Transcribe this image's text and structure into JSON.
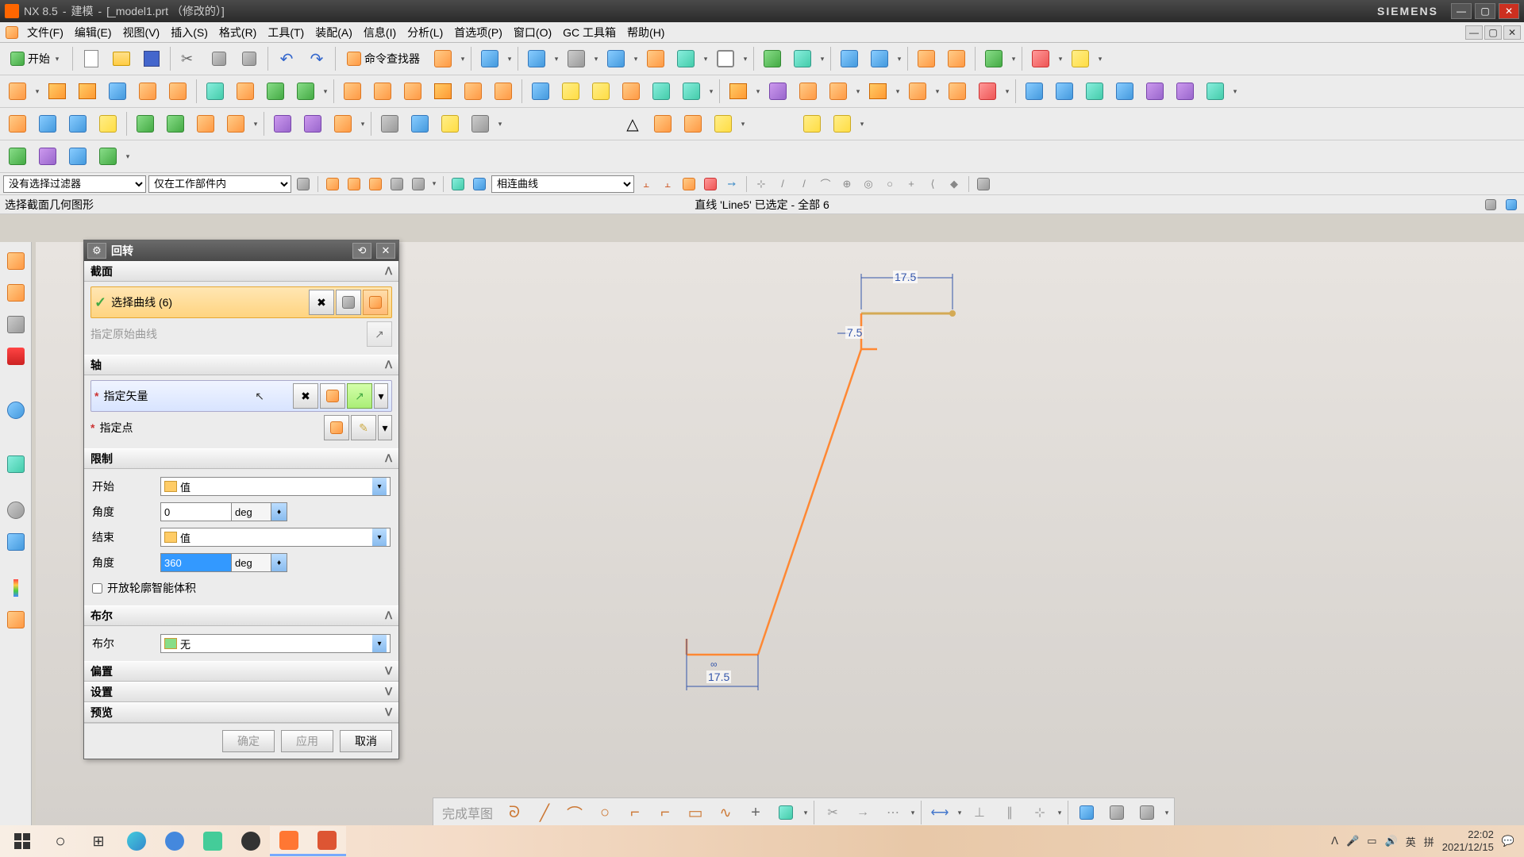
{
  "titlebar": {
    "app": "NX 8.5",
    "mode": "建模",
    "doc": "[_model1.prt （修改的）]",
    "brand": "SIEMENS"
  },
  "menu": {
    "items": [
      "文件(F)",
      "编辑(E)",
      "视图(V)",
      "插入(S)",
      "格式(R)",
      "工具(T)",
      "装配(A)",
      "信息(I)",
      "分析(L)",
      "首选项(P)",
      "窗口(O)",
      "GC 工具箱",
      "帮助(H)"
    ]
  },
  "toolbar1": {
    "start": "开始",
    "cmd_finder": "命令查找器"
  },
  "filter": {
    "sel1": "没有选择过滤器",
    "sel2": "仅在工作部件内",
    "sel3": "相连曲线"
  },
  "prompt": {
    "left": "选择截面几何图形",
    "center": "直线 'Line5' 已选定 - 全部 6"
  },
  "dialog": {
    "title": "回转",
    "sections": {
      "section": "截面",
      "axis": "轴",
      "limits": "限制",
      "boolean": "布尔",
      "offset": "偏置",
      "settings": "设置",
      "preview": "预览"
    },
    "select_curve": "选择曲线 (6)",
    "specify_orig": "指定原始曲线",
    "specify_vector": "指定矢量",
    "specify_point": "指定点",
    "start_label": "开始",
    "start_type": "值",
    "angle_label": "角度",
    "start_angle": "0",
    "end_label": "结束",
    "end_type": "值",
    "end_angle": "360",
    "unit": "deg",
    "open_profile": "开放轮廓智能体积",
    "bool_label": "布尔",
    "bool_val": "无",
    "ok": "确定",
    "apply": "应用",
    "cancel": "取消"
  },
  "canvas": {
    "dim1": "17.5",
    "dim2": "7.5",
    "dim3": "17.5",
    "finish_sketch": "完成草图"
  },
  "taskbar": {
    "ime1": "英",
    "ime2": "拼",
    "time": "22:02",
    "date": "2021/12/15"
  }
}
